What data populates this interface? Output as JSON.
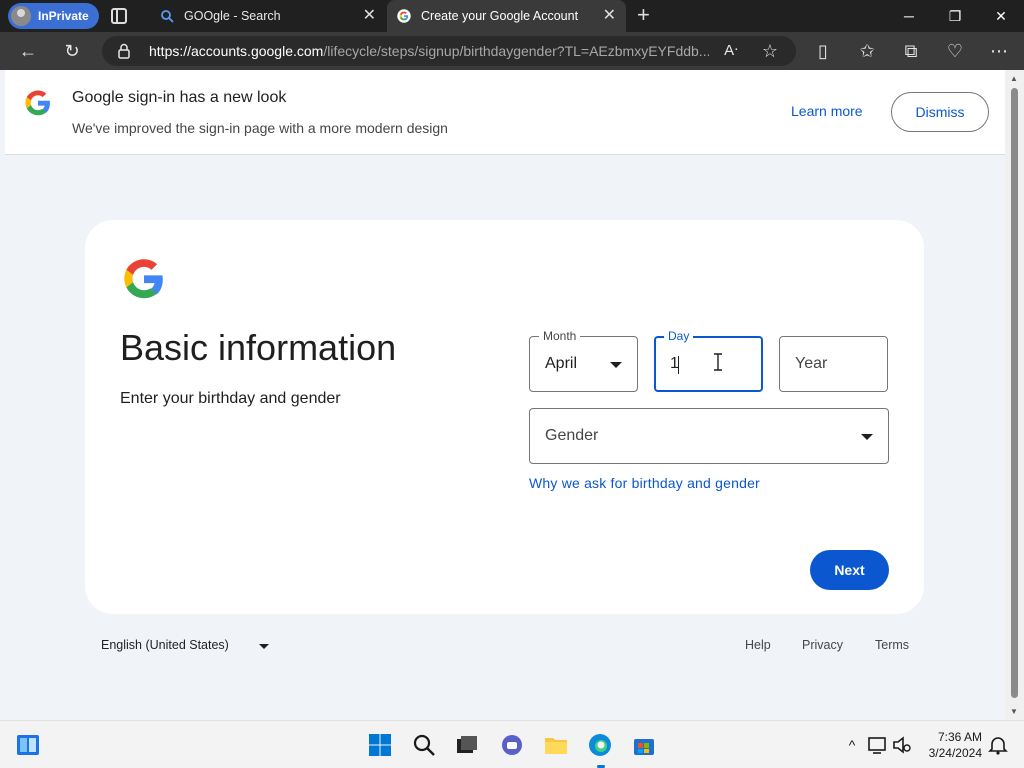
{
  "browser": {
    "inprivate_label": "InPrivate",
    "tabs": [
      {
        "label": "GOOgle - Search",
        "active": false
      },
      {
        "label": "Create your Google Account",
        "active": true
      }
    ],
    "url_host": "https://accounts.google.com",
    "url_path": "/lifecycle/steps/signup/birthdaygender?TL=AEzbmxyEYFddb..."
  },
  "banner": {
    "title": "Google sign-in has a new look",
    "subtitle": "We've improved the sign-in page with a more modern design",
    "learn_more": "Learn more",
    "dismiss": "Dismiss"
  },
  "card": {
    "headline": "Basic information",
    "lead": "Enter your birthday and gender",
    "month": {
      "label": "Month",
      "value": "April"
    },
    "day": {
      "label": "Day",
      "value": "1"
    },
    "year": {
      "placeholder": "Year"
    },
    "gender": {
      "placeholder": "Gender"
    },
    "why_link": "Why we ask for birthday and gender",
    "next": "Next"
  },
  "footer": {
    "language": "English (United States)",
    "links": [
      "Help",
      "Privacy",
      "Terms"
    ]
  },
  "taskbar": {
    "time": "7:36 AM",
    "date": "3/24/2024"
  },
  "colors": {
    "accent": "#0b57d0",
    "page_bg": "#f0f4f9"
  }
}
